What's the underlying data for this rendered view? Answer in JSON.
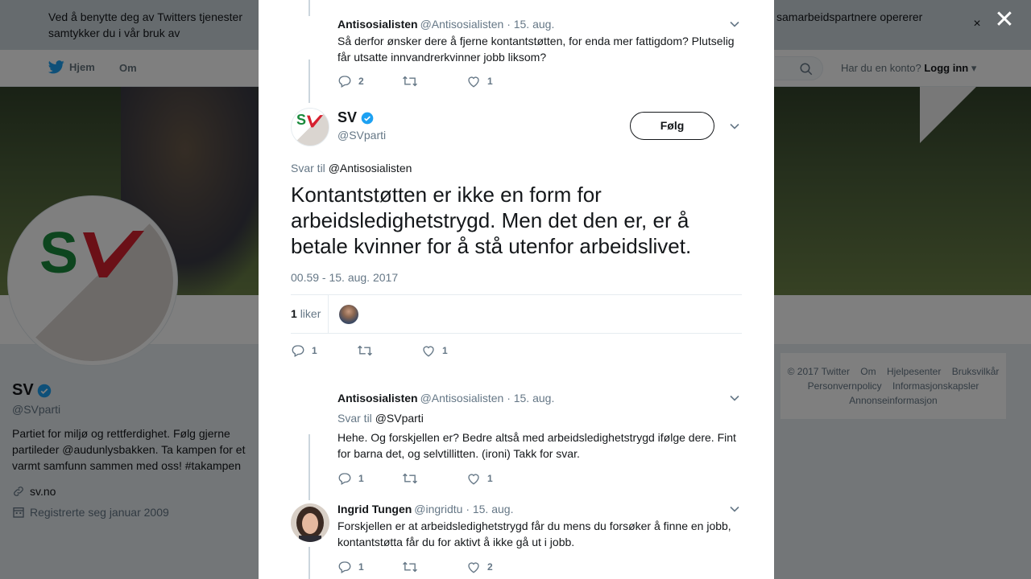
{
  "cookie_bar": {
    "text_left": "Ved å benytte deg av Twitters tjenester samtykker du i vår bruk av informasjonskapsler. Twitter og våre samarbeidspartnere opererer globalt, og bruker informasjonskapsler til blant annet analyse",
    "text_right": "samarbeidspartnere opererer",
    "close_glyph": "×"
  },
  "topnav": {
    "home_label": "Hjem",
    "about_label": "Om",
    "account_question": "Har du en konto?",
    "login_label": "Logg inn"
  },
  "profile": {
    "name": "SV",
    "handle": "@SVparti",
    "bio": "Partiet for miljø og rettferdighet. Følg gjerne partileder @audunlysbakken. Ta kampen for et varmt samfunn sammen med oss! #takampen",
    "website": "sv.no",
    "joined": "Registrerte seg januar 2009"
  },
  "footer": {
    "links": [
      "© 2017 Twitter",
      "Om",
      "Hjelpesenter",
      "Bruksvilkår",
      "Personvernpolicy",
      "Informasjonskapsler",
      "Annonseinformasjon"
    ]
  },
  "overlay": {
    "close_glyph": "✕"
  },
  "modal": {
    "parent_tweet": {
      "name": "Antisosialisten",
      "handle": "@Antisosialisten",
      "date": "· 15. aug.",
      "text": "Så derfor ønsker dere å fjerne kontantstøtten, for enda mer fattigdom? Plutselig får utsatte innvandrerkvinner jobb liksom?",
      "replies": "2",
      "retweets": "",
      "likes": "1"
    },
    "main_tweet": {
      "name": "SV",
      "handle": "@SVparti",
      "follow_label": "Følg",
      "reply_to_prefix": "Svar til",
      "reply_to_user": "@Antisosialisten",
      "text": "Kontantstøtten er ikke en form for arbeidsledighetstrygd. Men det den er, er å betale kvinner for å stå utenfor arbeidslivet.",
      "timestamp": "00.59 - 15. aug. 2017",
      "likes_count": "1",
      "likes_label": "liker",
      "replies": "1",
      "retweets": "",
      "likes": "1"
    },
    "replies": [
      {
        "name": "Antisosialisten",
        "handle": "@Antisosialisten",
        "date": "· 15. aug.",
        "reply_to_prefix": "Svar til",
        "reply_to_user": "@SVparti",
        "text": "Hehe. Og forskjellen er? Bedre altså med arbeidsledighetstrygd ifølge dere. Fint for barna det, og selvtillitten. (ironi) Takk for svar.",
        "replies": "1",
        "retweets": "",
        "likes": "1"
      },
      {
        "name": "Ingrid Tungen",
        "handle": "@ingridtu",
        "date": "· 15. aug.",
        "text": "Forskjellen er at arbeidsledighetstrygd får du mens du forsøker å finne en jobb, kontantstøtta får du for aktivt å ikke gå ut i jobb.",
        "replies": "1",
        "retweets": "",
        "likes": "2"
      }
    ]
  },
  "colors": {
    "twitter_blue": "#1da1f2",
    "verified": "#1da1f2",
    "sv_green": "#1a8a3c",
    "sv_red": "#d6202f",
    "secondary_text": "#657786"
  },
  "icons": [
    "twitter-bird-icon",
    "search-icon",
    "caret-down-icon",
    "verified-icon",
    "link-icon",
    "calendar-icon",
    "reply-icon",
    "retweet-icon",
    "like-icon",
    "chevron-down-icon",
    "close-icon"
  ]
}
